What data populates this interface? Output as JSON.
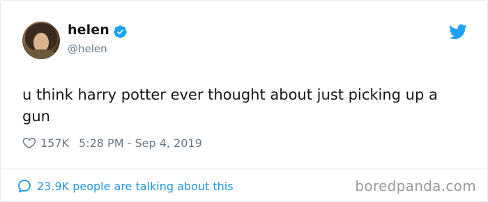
{
  "user": {
    "display_name": "helen",
    "handle": "@helen"
  },
  "tweet": {
    "text": "u think harry potter ever thought about just picking up a gun",
    "likes": "157K",
    "timestamp": "5:28 PM - Sep 4, 2019"
  },
  "footer": {
    "conversation_text": "23.9K people are talking about this"
  },
  "watermark": {
    "text": "boredpanda.com"
  },
  "icons": {
    "verified": "verified-badge-icon",
    "brand": "twitter-bird-icon",
    "like": "heart-icon",
    "reply": "speech-bubble-icon"
  },
  "colors": {
    "twitter_blue": "#1da1f2",
    "link_blue": "#1b95e0",
    "text_dark": "#14171a",
    "text_gray": "#657786",
    "border": "#e1e8ed"
  }
}
